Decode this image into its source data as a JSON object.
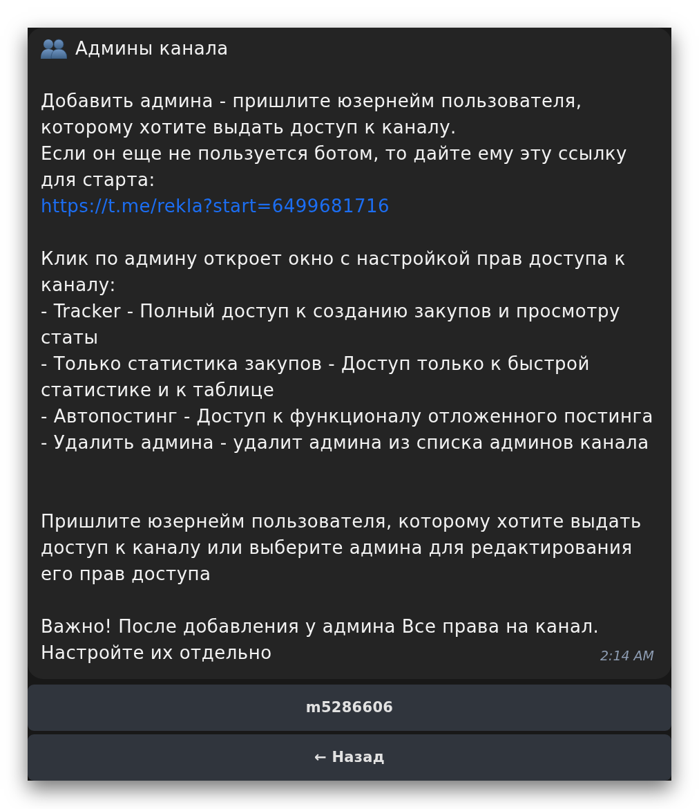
{
  "message": {
    "title": "Админы канала",
    "lines": [
      {
        "kind": "blank"
      },
      {
        "kind": "text",
        "text": "Добавить админа - пришлите юзернейм пользователя, которому хотите выдать доступ к каналу."
      },
      {
        "kind": "text",
        "text": "Если он еще не пользуется ботом, то дайте ему эту ссылку для старта:"
      },
      {
        "kind": "link",
        "text": "https://t.me/rekla?start=6499681716"
      },
      {
        "kind": "blank"
      },
      {
        "kind": "text",
        "text": "Клик по админу откроет окно с настройкой прав доступа к каналу:"
      },
      {
        "kind": "text",
        "text": "- Tracker - Полный доступ к созданию закупов и просмотру статы"
      },
      {
        "kind": "text",
        "text": "- Только статистика закупов - Доступ только к быстрой статистике и к таблице"
      },
      {
        "kind": "text",
        "text": "- Автопостинг - Доступ к функционалу отложенного постинга"
      },
      {
        "kind": "text",
        "text": "- Удалить админа - удалит админа из списка админов канала"
      },
      {
        "kind": "blank"
      },
      {
        "kind": "blank"
      },
      {
        "kind": "text",
        "text": "Пришлите юзернейм пользователя, которому хотите выдать доступ к каналу или выберите админа для редактирования его прав доступа"
      },
      {
        "kind": "blank"
      },
      {
        "kind": "text",
        "text": "Важно! После добавления у админа Все права на канал."
      },
      {
        "kind": "text",
        "text": "Настройте их отдельно"
      }
    ],
    "time": "2:14 AM"
  },
  "buttons": [
    {
      "label": "m5286606"
    },
    {
      "label": "← Назад"
    }
  ]
}
